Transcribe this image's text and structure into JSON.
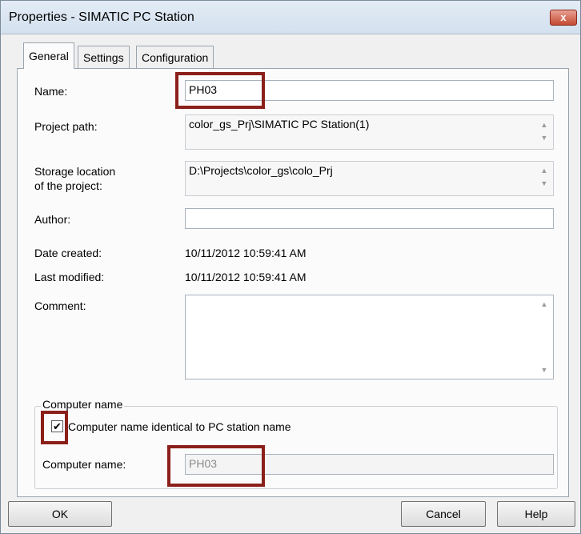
{
  "window": {
    "title": "Properties - SIMATIC PC Station",
    "close_glyph": "x"
  },
  "tabs": [
    {
      "label": "General",
      "active": true
    },
    {
      "label": "Settings",
      "active": false
    },
    {
      "label": "Configuration",
      "active": false
    }
  ],
  "general": {
    "name": {
      "label": "Name:",
      "value": "PH03"
    },
    "project_path": {
      "label": "Project path:",
      "value": "color_gs_Prj\\SIMATIC PC Station(1)"
    },
    "storage_location": {
      "label_line1": "Storage location",
      "label_line2": "of the project:",
      "value": "D:\\Projects\\color_gs\\colo_Prj"
    },
    "author": {
      "label": "Author:",
      "value": ""
    },
    "date_created": {
      "label": "Date created:",
      "value": "10/11/2012 10:59:41 AM"
    },
    "last_modified": {
      "label": "Last modified:",
      "value": "10/11/2012 10:59:41 AM"
    },
    "comment": {
      "label": "Comment:",
      "value": ""
    }
  },
  "computer_name_group": {
    "legend": "Computer name",
    "checkbox_label": "Computer name identical to PC station name",
    "checkbox_checked": true,
    "check_glyph": "✔",
    "field_label": "Computer name:",
    "field_value": "PH03"
  },
  "buttons": {
    "ok": "OK",
    "cancel": "Cancel",
    "help": "Help"
  },
  "scroll_glyphs": {
    "up": "▲",
    "down": "▼"
  },
  "colors": {
    "highlight": "#8b1f1a",
    "title_bar": "#d3e0ee",
    "close_button": "#c44a32"
  }
}
